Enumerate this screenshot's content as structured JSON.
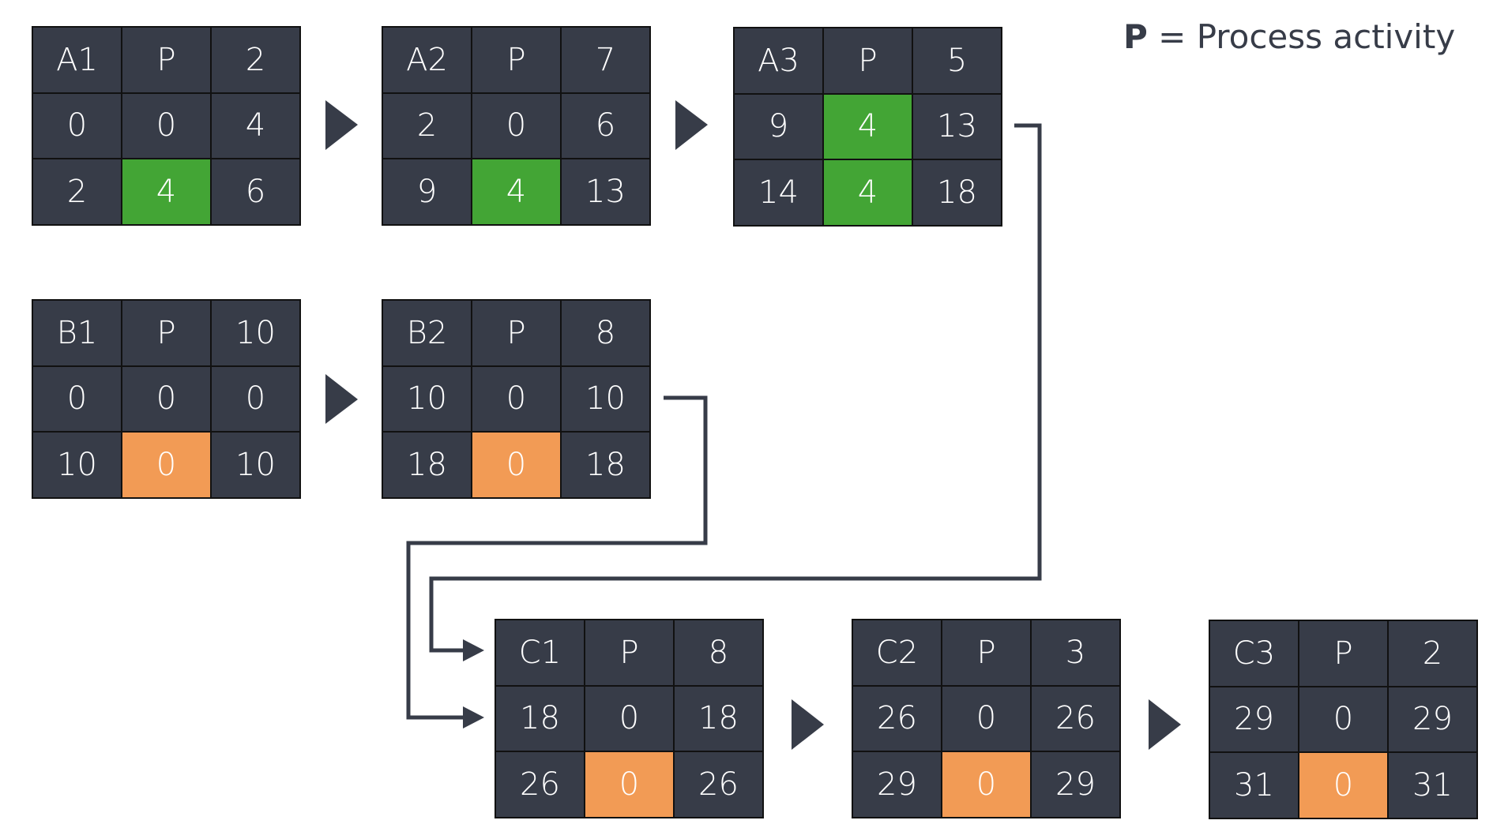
{
  "legend": {
    "key": "P",
    "text": " = Process activity"
  },
  "colors": {
    "cell": "#373c48",
    "critical": "#43a535",
    "slack": "#f29b55",
    "connector": "#373c48"
  },
  "nodes": [
    {
      "id": "A1",
      "highlight": "critical",
      "cells": [
        [
          "A1",
          "P",
          "2"
        ],
        [
          "0",
          "0",
          "4"
        ],
        [
          "2",
          "4",
          "6"
        ]
      ]
    },
    {
      "id": "A2",
      "highlight": "critical",
      "cells": [
        [
          "A2",
          "P",
          "7"
        ],
        [
          "2",
          "0",
          "6"
        ],
        [
          "9",
          "4",
          "13"
        ]
      ]
    },
    {
      "id": "A3",
      "highlight": "critical",
      "cells": [
        [
          "A3",
          "P",
          "5"
        ],
        [
          "9",
          "4",
          "13"
        ],
        [
          "14",
          "4",
          "18"
        ]
      ]
    },
    {
      "id": "B1",
      "highlight": "slack",
      "cells": [
        [
          "B1",
          "P",
          "10"
        ],
        [
          "0",
          "0",
          "0"
        ],
        [
          "10",
          "0",
          "10"
        ]
      ]
    },
    {
      "id": "B2",
      "highlight": "slack",
      "cells": [
        [
          "B2",
          "P",
          "8"
        ],
        [
          "10",
          "0",
          "10"
        ],
        [
          "18",
          "0",
          "18"
        ]
      ]
    },
    {
      "id": "C1",
      "highlight": "slack",
      "cells": [
        [
          "C1",
          "P",
          "8"
        ],
        [
          "18",
          "0",
          "18"
        ],
        [
          "26",
          "0",
          "26"
        ]
      ]
    },
    {
      "id": "C2",
      "highlight": "slack",
      "cells": [
        [
          "C2",
          "P",
          "3"
        ],
        [
          "26",
          "0",
          "26"
        ],
        [
          "29",
          "0",
          "29"
        ]
      ]
    },
    {
      "id": "C3",
      "highlight": "slack",
      "cells": [
        [
          "C3",
          "P",
          "2"
        ],
        [
          "29",
          "0",
          "29"
        ],
        [
          "31",
          "0",
          "31"
        ]
      ]
    }
  ],
  "links": [
    {
      "from": "A1",
      "to": "A2"
    },
    {
      "from": "A2",
      "to": "A3"
    },
    {
      "from": "B1",
      "to": "B2"
    },
    {
      "from": "A3",
      "to": "C1"
    },
    {
      "from": "B2",
      "to": "C1"
    },
    {
      "from": "C1",
      "to": "C2"
    },
    {
      "from": "C2",
      "to": "C3"
    }
  ]
}
